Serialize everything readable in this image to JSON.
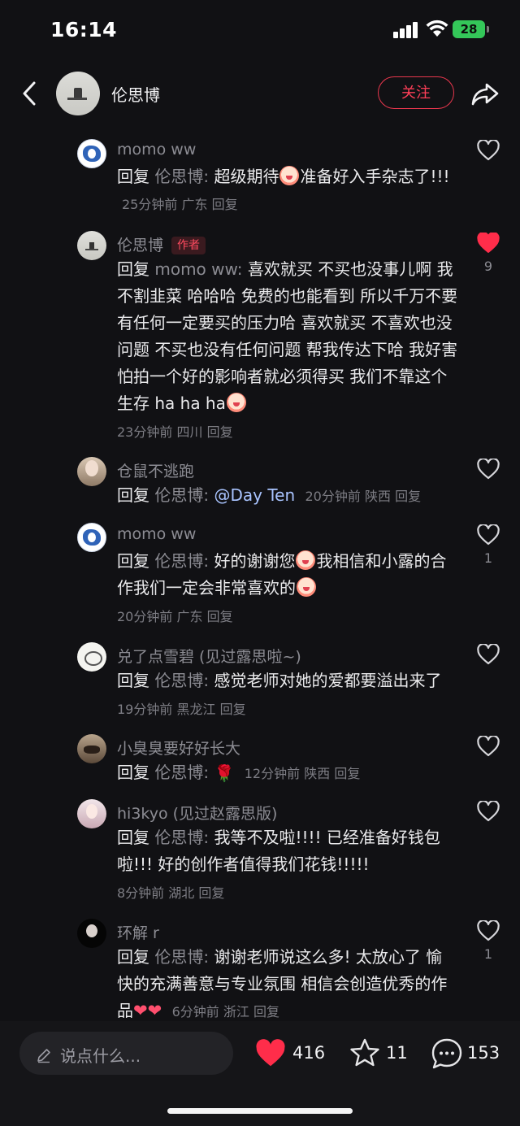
{
  "status_bar": {
    "time": "16:14",
    "battery": "28"
  },
  "header": {
    "name": "伦思博",
    "follow_label": "关注"
  },
  "comments": [
    {
      "user": "momo ww",
      "prefix": "回复",
      "reply_to": "伦思博:",
      "body_a": "超级期待",
      "body_b": "准备好入手杂志了!!!",
      "time": "25分钟前",
      "location": "广东",
      "reply_label": "回复",
      "likes": ""
    },
    {
      "user": "伦思博",
      "badge": "作者",
      "prefix": "回复",
      "reply_to": "momo ww:",
      "body": "喜欢就买 不买也没事儿啊 我不割韭菜 哈哈哈 免费的也能看到 所以千万不要有任何一定要买的压力哈 喜欢就买 不喜欢也没问题 不买也没有任何问题 帮我传达下哈 我好害怕拍一个好的影响者就必须得买 我们不靠这个生存 ha ha ha",
      "time": "23分钟前",
      "location": "四川",
      "reply_label": "回复",
      "likes": "9"
    },
    {
      "user": "仓鼠不逃跑",
      "prefix": "回复",
      "reply_to": "伦思博:",
      "mention": "@Day Ten",
      "time": "20分钟前",
      "location": "陕西",
      "reply_label": "回复",
      "likes": ""
    },
    {
      "user": "momo ww",
      "prefix": "回复",
      "reply_to": "伦思博:",
      "body_a": "好的谢谢您",
      "body_b": "我相信和小露的合作我们一定会非常喜欢的",
      "time": "20分钟前",
      "location": "广东",
      "reply_label": "回复",
      "likes": "1"
    },
    {
      "user": "兑了点雪碧 (见过露思啦~)",
      "prefix": "回复",
      "reply_to": "伦思博:",
      "body": "感觉老师对她的爱都要溢出来了",
      "time": "19分钟前",
      "location": "黑龙江",
      "reply_label": "回复",
      "likes": ""
    },
    {
      "user": "小臭臭要好好长大",
      "prefix": "回复",
      "reply_to": "伦思博:",
      "emoji": "🌹",
      "time": "12分钟前",
      "location": "陕西",
      "reply_label": "回复",
      "likes": ""
    },
    {
      "user": "hi3kyo (见过赵露思版)",
      "prefix": "回复",
      "reply_to": "伦思博:",
      "body": "我等不及啦!!!! 已经准备好钱包啦!!! 好的创作者值得我们花钱!!!!!",
      "time": "8分钟前",
      "location": "湖北",
      "reply_label": "回复",
      "likes": ""
    },
    {
      "user": "环解 r",
      "prefix": "回复",
      "reply_to": "伦思博:",
      "body": "谢谢老师说这么多! 太放心了 愉快的充满善意与专业氛围 相信会创造优秀的作品",
      "hearts": "❤❤",
      "time": "6分钟前",
      "location": "浙江",
      "reply_label": "回复",
      "likes": "1"
    }
  ],
  "bottom_bar": {
    "input_placeholder": "说点什么...",
    "likes": "416",
    "stars": "11",
    "comments": "153"
  },
  "colors": {
    "accent": "#ff3f58",
    "background": "#111114",
    "liked": "#ff2d4a"
  }
}
